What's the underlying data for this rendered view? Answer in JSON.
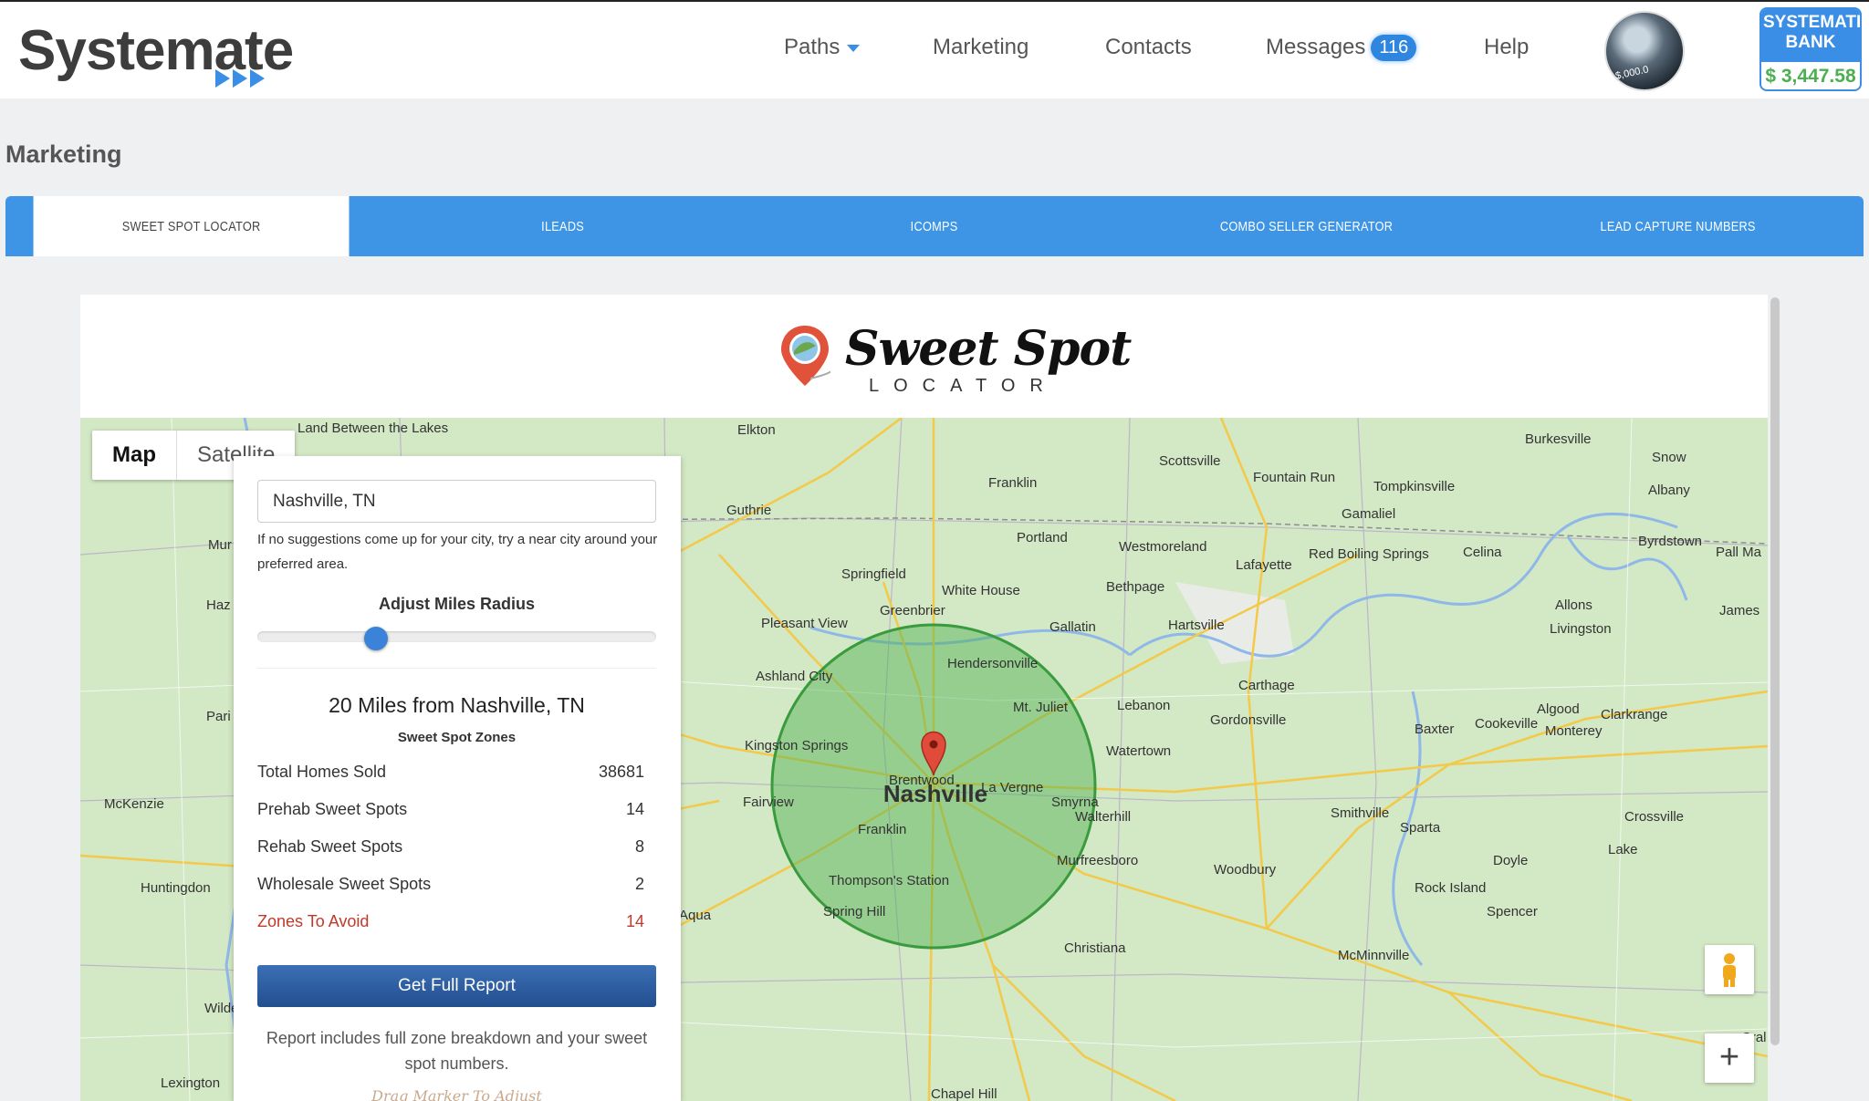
{
  "header": {
    "brand": "Systemate",
    "nav": [
      {
        "label": "Paths",
        "has_dropdown": true
      },
      {
        "label": "Marketing"
      },
      {
        "label": "Contacts"
      },
      {
        "label": "Messages",
        "badge": "116"
      },
      {
        "label": "Help"
      }
    ],
    "avatar_text": "$,000.0",
    "bank": {
      "line1": "SYSTEMATE",
      "line2": "BANK",
      "amount": "$ 3,447.58"
    }
  },
  "page": {
    "title": "Marketing"
  },
  "tabs": [
    {
      "label": "SWEET SPOT LOCATOR",
      "active": true
    },
    {
      "label": "ILEADS"
    },
    {
      "label": "ICOMPS"
    },
    {
      "label": "COMBO SELLER GENERATOR"
    },
    {
      "label": "LEAD CAPTURE NUMBERS"
    }
  ],
  "locator": {
    "logo_title": "Sweet Spot",
    "logo_sub": "LOCATOR",
    "map_type": {
      "map": "Map",
      "satellite": "Satellite"
    },
    "city_value": "Nashville, TN",
    "hint": "If no suggestions come up for your city, try a near city around your preferred area.",
    "radius_label": "Adjust Miles Radius",
    "radius_miles": 20,
    "result_title": "20 Miles from Nashville, TN",
    "zones_label": "Sweet Spot Zones",
    "stats": [
      {
        "label": "Total Homes Sold",
        "value": "38681"
      },
      {
        "label": "Prehab Sweet Spots",
        "value": "14"
      },
      {
        "label": "Rehab Sweet Spots",
        "value": "8"
      },
      {
        "label": "Wholesale Sweet Spots",
        "value": "2"
      },
      {
        "label": "Zones To Avoid",
        "value": "14",
        "warn": true
      }
    ],
    "report_button": "Get Full Report",
    "report_note": "Report includes full zone breakdown and your sweet spot numbers.",
    "drag_hint": "Drag Marker To Adjust"
  },
  "map": {
    "center_label": "Nashville",
    "places": [
      "Elkton",
      "Franklin",
      "Scottsville",
      "Burkesville",
      "Snow",
      "Albany",
      "Fountain Run",
      "Tompkinsville",
      "Guthrie",
      "Portland",
      "Gamaliel",
      "Westmoreland",
      "Red Boiling Springs",
      "Lafayette",
      "Celina",
      "Byrdstown",
      "Pall Ma",
      "Springfield",
      "White House",
      "Bethpage",
      "Allons",
      "James",
      "Greenbrier",
      "Pleasant View",
      "Gallatin",
      "Hartsville",
      "Livingston",
      "Hendersonville",
      "Ashland City",
      "Carthage",
      "Mt. Juliet",
      "Lebanon",
      "Gordonsville",
      "Algood",
      "Clarkrange",
      "Baxter",
      "Cookeville",
      "Monterey",
      "Kingston Springs",
      "Watertown",
      "Brentwood",
      "La Vergne",
      "Smyrna",
      "Fairview",
      "Walterhill",
      "Smithville",
      "Crossville",
      "Franklin",
      "Sparta",
      "Lake",
      "Murfreesboro",
      "Woodbury",
      "Doyle",
      "Thompson's Station",
      "Rock Island",
      "Spring Hill",
      "Spencer",
      "Christiana",
      "McMinnville",
      "Chapel Hill",
      "Land Between the Lakes",
      "Mur",
      "Haz",
      "Pari",
      "McKenzie",
      "Huntingdon",
      "Wildersvi",
      "Lexington",
      "Aqua",
      "Cral"
    ]
  }
}
